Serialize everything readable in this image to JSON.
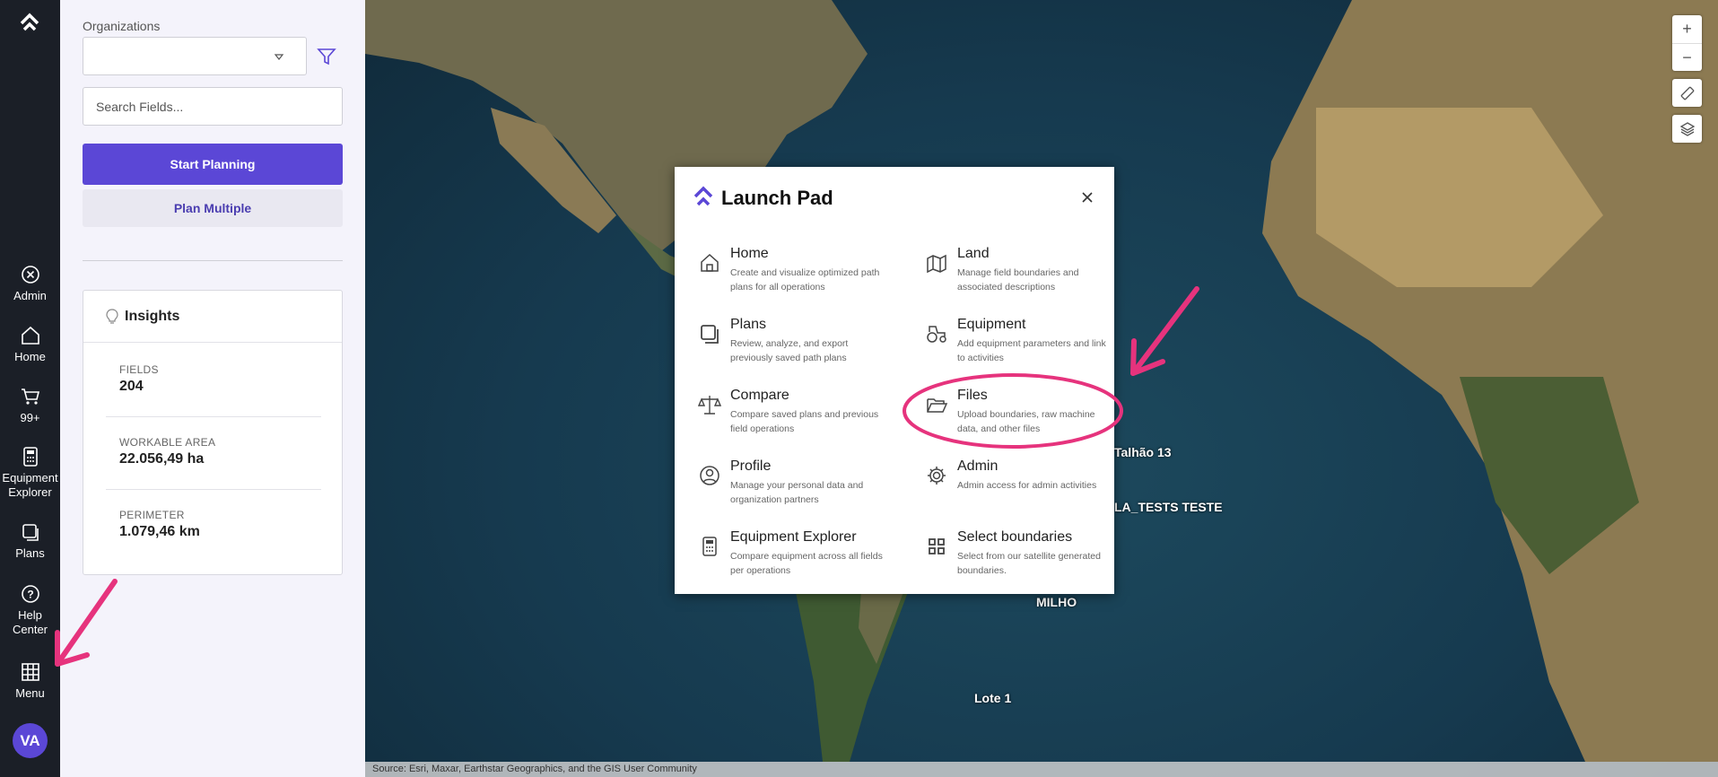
{
  "rail": {
    "items": [
      {
        "label": "Admin",
        "icon": "close-circle-icon"
      },
      {
        "label": "Home",
        "icon": "home-icon"
      },
      {
        "label": "99+",
        "icon": "cart-icon"
      },
      {
        "label": "Equipment Explorer",
        "icon": "calculator-icon"
      },
      {
        "label": "Plans",
        "icon": "copy-icon"
      },
      {
        "label": "Help Center",
        "icon": "help-icon"
      },
      {
        "label": "Menu",
        "icon": "grid-icon"
      }
    ],
    "avatar": "VA"
  },
  "panel": {
    "org_label": "Organizations",
    "org_value": "",
    "search_placeholder": "Search Fields...",
    "start_planning": "Start Planning",
    "plan_multiple": "Plan Multiple",
    "insights": {
      "title": "Insights",
      "metrics": [
        {
          "label": "FIELDS",
          "value": "204"
        },
        {
          "label": "WORKABLE AREA",
          "value": "22.056,49 ha"
        },
        {
          "label": "PERIMETER",
          "value": "1.079,46 km"
        }
      ]
    }
  },
  "map": {
    "labels": [
      "Talhão 13",
      "LA_TESTS TESTE",
      "MILHO",
      "Lote 1"
    ],
    "attribution": "Source: Esri, Maxar, Earthstar Geographics, and the GIS User Community",
    "controls": [
      "+",
      "−"
    ]
  },
  "launchpad": {
    "title": "Launch Pad",
    "tiles": [
      {
        "title": "Home",
        "desc": "Create and visualize optimized path plans for all operations",
        "icon": "home-icon"
      },
      {
        "title": "Land",
        "desc": "Manage field boundaries and associated descriptions",
        "icon": "map-icon"
      },
      {
        "title": "Plans",
        "desc": "Review, analyze, and export previously saved path plans",
        "icon": "copy-icon"
      },
      {
        "title": "Equipment",
        "desc": "Add equipment parameters and link to activities",
        "icon": "tractor-icon"
      },
      {
        "title": "Compare",
        "desc": "Compare saved plans and previous field operations",
        "icon": "scale-icon"
      },
      {
        "title": "Files",
        "desc": "Upload boundaries, raw machine data, and other files",
        "icon": "folder-icon"
      },
      {
        "title": "Profile",
        "desc": "Manage your personal data and organization partners",
        "icon": "user-circle-icon"
      },
      {
        "title": "Admin",
        "desc": "Admin access for admin activities",
        "icon": "gear-icon"
      },
      {
        "title": "Equipment Explorer",
        "desc": "Compare equipment across all fields per operations",
        "icon": "calculator-icon"
      },
      {
        "title": "Select boundaries",
        "desc": "Select from our satellite generated boundaries.",
        "icon": "grid-icon"
      }
    ]
  },
  "colors": {
    "accent": "#5b47d6",
    "annotation": "#e6337d",
    "rail_bg": "#1b1f27",
    "panel_bg": "#f4f3fb"
  }
}
